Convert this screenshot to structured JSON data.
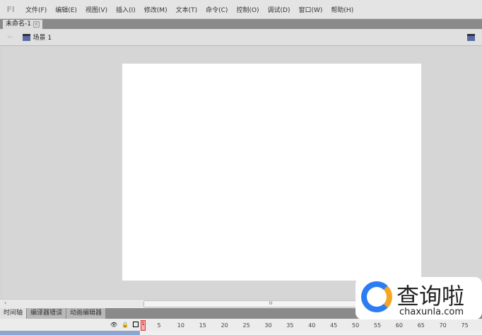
{
  "app": {
    "logo": "Fl"
  },
  "menu": [
    "文件(F)",
    "编辑(E)",
    "视图(V)",
    "插入(I)",
    "修改(M)",
    "文本(T)",
    "命令(C)",
    "控制(O)",
    "调试(D)",
    "窗口(W)",
    "帮助(H)"
  ],
  "document_tab": {
    "label": "未命名-1",
    "close_icon": "close-icon"
  },
  "scene": {
    "label": "场景 1"
  },
  "timeline": {
    "tabs": [
      "时间轴",
      "编译器错误",
      "动画编辑器"
    ],
    "current_frame": "1",
    "ruler": [
      "5",
      "10",
      "15",
      "20",
      "25",
      "30",
      "35",
      "40",
      "45",
      "50",
      "55",
      "60",
      "65",
      "70",
      "75"
    ]
  },
  "watermark": {
    "text": "查询啦",
    "url": "chaxunla.com"
  },
  "colors": {
    "stage": "#ffffff",
    "workspace": "#d6d6d6",
    "layer_selected": "#8ea5cf"
  }
}
